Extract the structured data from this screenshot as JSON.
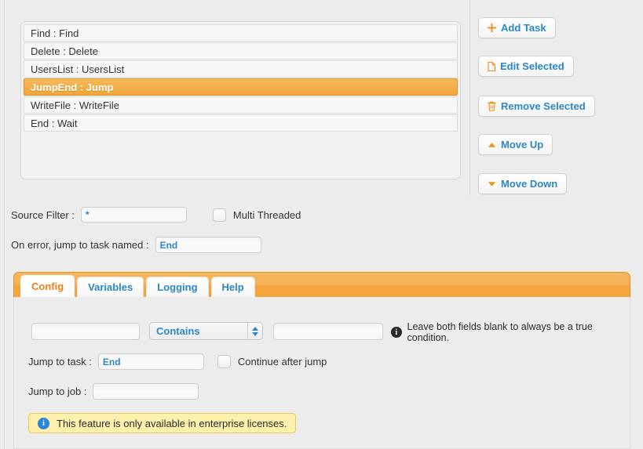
{
  "task_list": {
    "items": [
      {
        "label": "Find : Find",
        "selected": false
      },
      {
        "label": "Delete : Delete",
        "selected": false
      },
      {
        "label": "UsersList : UsersList",
        "selected": false
      },
      {
        "label": "JumpEnd : Jump",
        "selected": true
      },
      {
        "label": "WriteFile : WriteFile",
        "selected": false
      },
      {
        "label": "End : Wait",
        "selected": false
      }
    ]
  },
  "actions": {
    "add_task": "Add Task",
    "edit_selected": "Edit Selected",
    "remove_selected": "Remove Selected",
    "move_up": "Move Up",
    "move_down": "Move Down",
    "icons": {
      "add": "plus-icon",
      "edit": "document-icon",
      "remove": "trash-icon",
      "up": "triangle-up-icon",
      "down": "triangle-down-icon"
    }
  },
  "form": {
    "source_filter_label": "Source Filter :",
    "source_filter_value": "*",
    "multi_threaded_label": "Multi Threaded",
    "multi_threaded_checked": false,
    "on_error_label": "On error, jump to task named :",
    "on_error_value": "End"
  },
  "tabs": [
    {
      "label": "Config",
      "active": true
    },
    {
      "label": "Variables",
      "active": false
    },
    {
      "label": "Logging",
      "active": false
    },
    {
      "label": "Help",
      "active": false
    }
  ],
  "config": {
    "condition_left_value": "",
    "condition_operator": "Contains",
    "condition_right_value": "",
    "hint_text": "Leave both fields blank to always be a true condition.",
    "jump_to_task_label": "Jump to task :",
    "jump_to_task_value": "End",
    "continue_after_jump_label": "Continue after jump",
    "continue_after_jump_checked": false,
    "jump_to_job_label": "Jump to job :",
    "jump_to_job_value": "",
    "enterprise_notice": "This feature is only available in enterprise licenses."
  },
  "colors": {
    "accent_orange": "#f0a73c",
    "link_blue": "#2b87c4",
    "tab_active_orange": "#ef7f1a",
    "alert_bg": "#fdf0ad",
    "alert_border": "#e9c95c",
    "page_bg": "#ececec"
  }
}
